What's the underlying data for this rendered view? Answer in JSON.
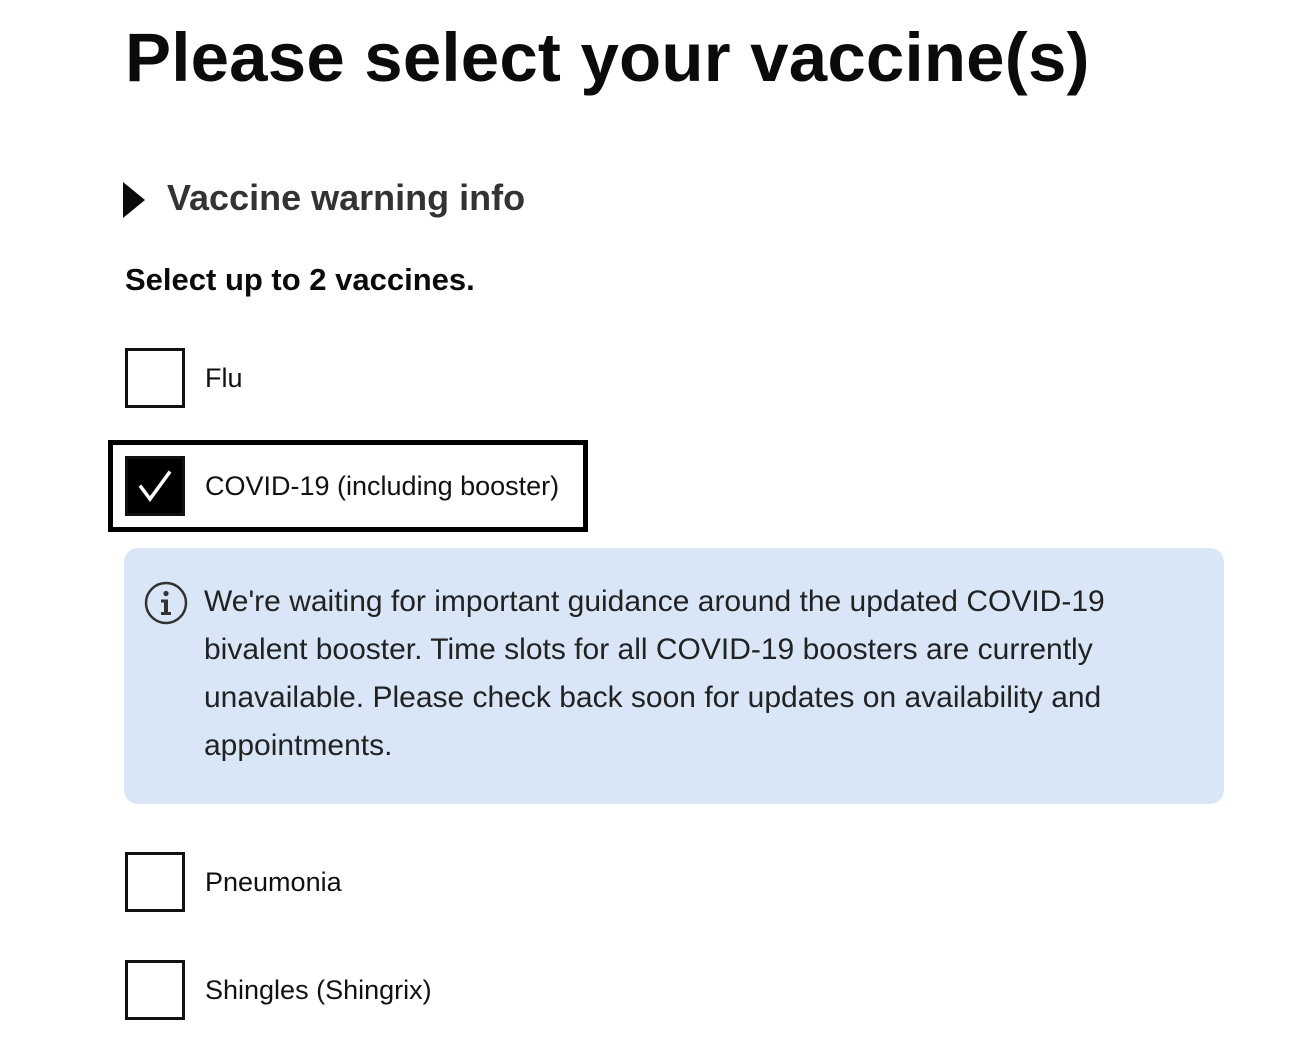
{
  "page": {
    "title": "Please select your vaccine(s)"
  },
  "warning_disclosure": {
    "label": "Vaccine warning info",
    "expanded": false
  },
  "instruction": "Select up to 2 vaccines.",
  "vaccines": [
    {
      "label": "Flu",
      "checked": false
    },
    {
      "label": "COVID-19 (including booster)",
      "checked": true
    },
    {
      "label": "Pneumonia",
      "checked": false
    },
    {
      "label": "Shingles (Shingrix)",
      "checked": false
    }
  ],
  "covid_notice": {
    "icon": "info-icon",
    "text": "We're waiting for important guidance around the updated COVID-19 bivalent booster. Time slots for all COVID-19 boosters are currently unavailable. Please check back soon for updates on availability and appointments."
  },
  "colors": {
    "notice_background": "#d8e6f8",
    "checkbox_checked": "#000000"
  }
}
